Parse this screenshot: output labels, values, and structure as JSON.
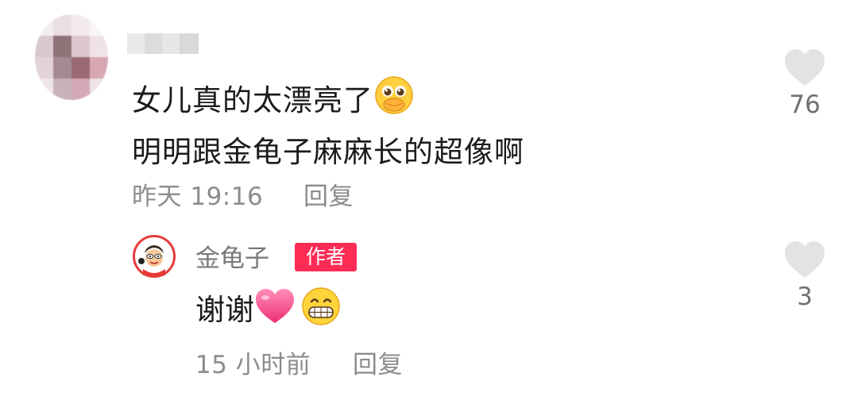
{
  "comment": {
    "text_line1": "女儿真的太漂亮了",
    "text_line2": "明明跟金龟子麻麻长的超像啊",
    "time": "昨天 19:16",
    "reply_label": "回复",
    "likes": "76",
    "emoji": "pleading-hands-over-mouth-emoji"
  },
  "reply": {
    "username": "金龟子",
    "badge": "作者",
    "text": "谢谢",
    "emojis": [
      "pink-heart-emoji",
      "grinning-face-emoji"
    ],
    "time": "15 小时前",
    "reply_label": "回复",
    "likes": "3"
  },
  "colors": {
    "badge": "#fe2c55",
    "heart": "#e3e3e3",
    "text": "#1b1b1b",
    "meta": "#8c8c8c"
  }
}
